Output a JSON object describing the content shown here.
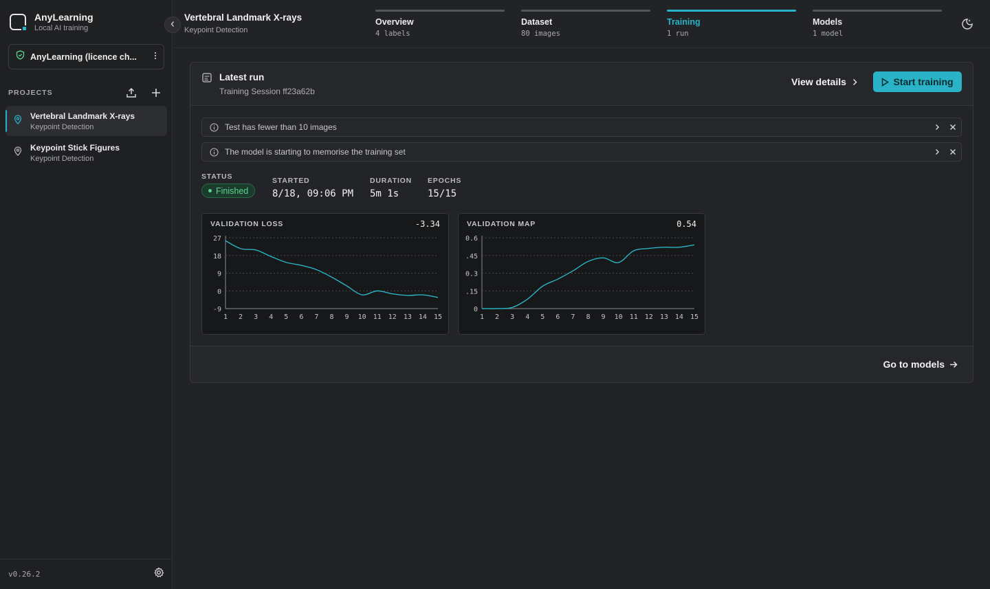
{
  "app": {
    "name": "AnyLearning",
    "subtitle": "Local AI training"
  },
  "licence": {
    "label": "AnyLearning (licence ch..."
  },
  "projects": {
    "header": "PROJECTS",
    "items": [
      {
        "name": "Vertebral Landmark X-rays",
        "type": "Keypoint Detection",
        "active": true
      },
      {
        "name": "Keypoint Stick Figures",
        "type": "Keypoint Detection",
        "active": false
      }
    ]
  },
  "version": "v0.26.2",
  "page": {
    "title": "Vertebral Landmark X-rays",
    "subtitle": "Keypoint Detection"
  },
  "steps": [
    {
      "title": "Overview",
      "sub": "4 labels",
      "active": false
    },
    {
      "title": "Dataset",
      "sub": "80 images",
      "active": false
    },
    {
      "title": "Training",
      "sub": "1 run",
      "active": true
    },
    {
      "title": "Models",
      "sub": "1 model",
      "active": false
    }
  ],
  "run": {
    "title": "Latest run",
    "session": "Training Session ff23a62b",
    "view_details": "View details",
    "start_training": "Start training"
  },
  "warnings": [
    "Test has fewer than 10 images",
    "The model is starting to memorise the training set"
  ],
  "stats": {
    "status_label": "STATUS",
    "status_value": "Finished",
    "started_label": "STARTED",
    "started_value": "8/18, 09:06 PM",
    "duration_label": "DURATION",
    "duration_value": "5m 1s",
    "epochs_label": "EPOCHS",
    "epochs_value": "15/15"
  },
  "footer": {
    "go_to_models": "Go to models"
  },
  "colors": {
    "accent": "#2ab3c6",
    "success": "#5fd392",
    "background": "#222326"
  },
  "chart_data": [
    {
      "type": "line",
      "title": "VALIDATION LOSS",
      "last_value": "-3.34",
      "x": [
        1,
        2,
        3,
        4,
        5,
        6,
        7,
        8,
        9,
        10,
        11,
        12,
        13,
        14,
        15
      ],
      "values": [
        25.5,
        21.5,
        20.8,
        17.5,
        14.5,
        13.0,
        10.8,
        7.0,
        2.5,
        -2.0,
        0.0,
        -1.5,
        -2.3,
        -2.0,
        -3.34
      ],
      "yticks": [
        "27",
        "18",
        "9",
        "0",
        "-9"
      ],
      "ylim": [
        -9,
        27
      ],
      "grid": true
    },
    {
      "type": "line",
      "title": "VALIDATION MAP",
      "last_value": "0.54",
      "x": [
        1,
        2,
        3,
        4,
        5,
        6,
        7,
        8,
        9,
        10,
        11,
        12,
        13,
        14,
        15
      ],
      "values": [
        0.0,
        0.0,
        0.01,
        0.08,
        0.19,
        0.25,
        0.32,
        0.4,
        0.43,
        0.39,
        0.49,
        0.51,
        0.52,
        0.52,
        0.54
      ],
      "yticks": [
        "0.6",
        ".45",
        "0.3",
        ".15",
        "0"
      ],
      "ylim": [
        0,
        0.6
      ],
      "grid": true
    }
  ]
}
